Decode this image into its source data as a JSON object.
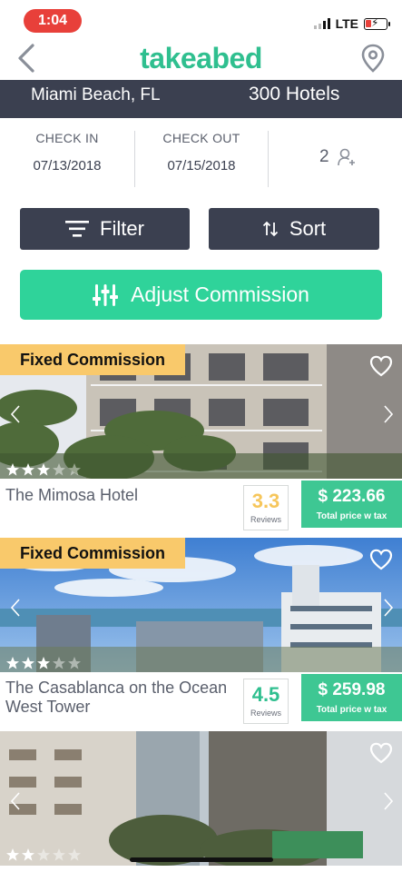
{
  "status_bar": {
    "time": "1:04",
    "network": "LTE"
  },
  "nav": {
    "logo": "takeabed",
    "back_icon": "chevron-left-icon",
    "location_icon": "map-pin-icon"
  },
  "location_bar": {
    "city": "Miami Beach, FL",
    "hotel_count": "300 Hotels"
  },
  "dates": {
    "check_in_label": "CHECK IN",
    "check_in_value": "07/13/2018",
    "check_out_label": "CHECK OUT",
    "check_out_value": "07/15/2018",
    "guests": "2"
  },
  "actions": {
    "filter_label": "Filter",
    "sort_label": "Sort",
    "adjust_label": "Adjust Commission"
  },
  "colors": {
    "brand": "#2fbf8f",
    "dark": "#3b4050",
    "accent_button": "#2fd39a",
    "price_bg": "#3ec793",
    "badge": "#f9c96b",
    "rating_gold": "#f6c65b",
    "rating_green": "#2fbf8f"
  },
  "hotels": [
    {
      "badge": "Fixed Commission",
      "name": "The Mimosa Hotel",
      "stars": 3,
      "rating": "3.3",
      "reviews_label": "Reviews",
      "price": "$ 223.66",
      "price_note": "Total price w tax"
    },
    {
      "badge": "Fixed Commission",
      "name": "The Casablanca on the Ocean West Tower",
      "stars": 3,
      "rating": "4.5",
      "reviews_label": "Reviews",
      "price": "$ 259.98",
      "price_note": "Total price w tax"
    },
    {
      "stars": 2
    }
  ]
}
